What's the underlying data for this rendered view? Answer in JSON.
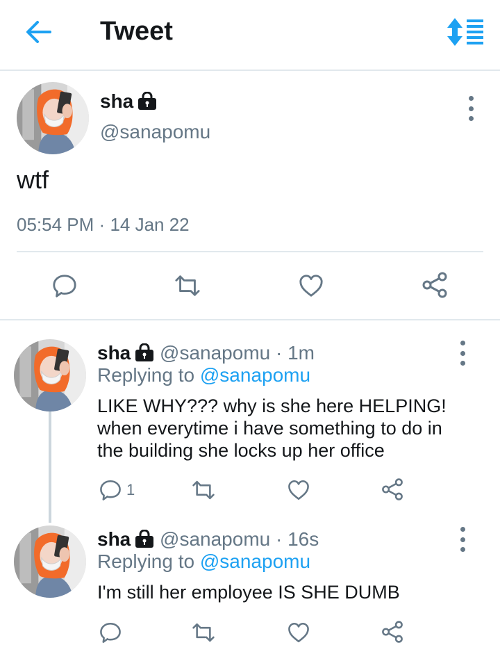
{
  "header": {
    "title": "Tweet",
    "back_icon": "arrow-left-icon",
    "sort_icon": "sort-arrows-icon",
    "accent": "#1da1f2"
  },
  "main_tweet": {
    "display_name": "sha",
    "handle": "@sanapomu",
    "text": "wtf",
    "time": "05:54 PM",
    "separator": "·",
    "date": "14 Jan 22",
    "actions": [
      "reply-icon",
      "retweet-icon",
      "like-icon",
      "share-icon"
    ]
  },
  "replies": [
    {
      "display_name": "sha",
      "handle": "@sanapomu",
      "separator": "·",
      "age": "1m",
      "replying_label": "Replying to",
      "replying_handle": "@sanapomu",
      "text_lines": [
        "LIKE WHY??? why is she here HELPING!",
        "when everytime i have something to do in",
        "the building she locks up her office"
      ],
      "reply_count": "1"
    },
    {
      "display_name": "sha",
      "handle": "@sanapomu",
      "separator": "·",
      "age": "16s",
      "replying_label": "Replying to",
      "replying_handle": "@sanapomu",
      "text_lines": [
        "I'm still her employee IS SHE DUMB"
      ],
      "reply_count": ""
    }
  ],
  "colors": {
    "text": "#14171a",
    "muted": "#657786",
    "divider": "#e1e8ed",
    "hair": "#f26b2a"
  }
}
